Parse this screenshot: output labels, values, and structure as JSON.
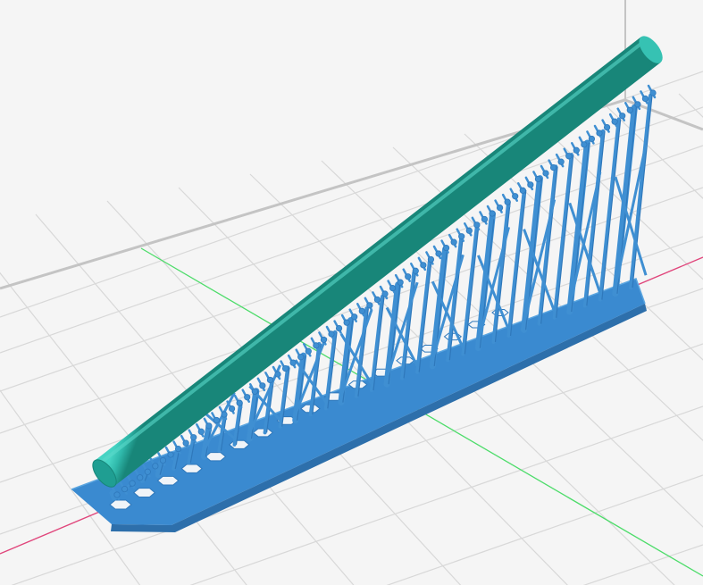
{
  "viewport": {
    "background": "#f5f5f5",
    "grid_color": "#d8d8d8",
    "build_volume_edge_color": "#c4c4c4",
    "axis_x_color": "#e0457b",
    "axis_y_color": "#4ddc6a"
  },
  "model": {
    "name": "cylindrical-rod",
    "color": "#2fb8aa",
    "supports": {
      "color": "#3f8fd2",
      "shade_color": "#2f78bb",
      "raft_color": "#3a8ad0"
    }
  }
}
